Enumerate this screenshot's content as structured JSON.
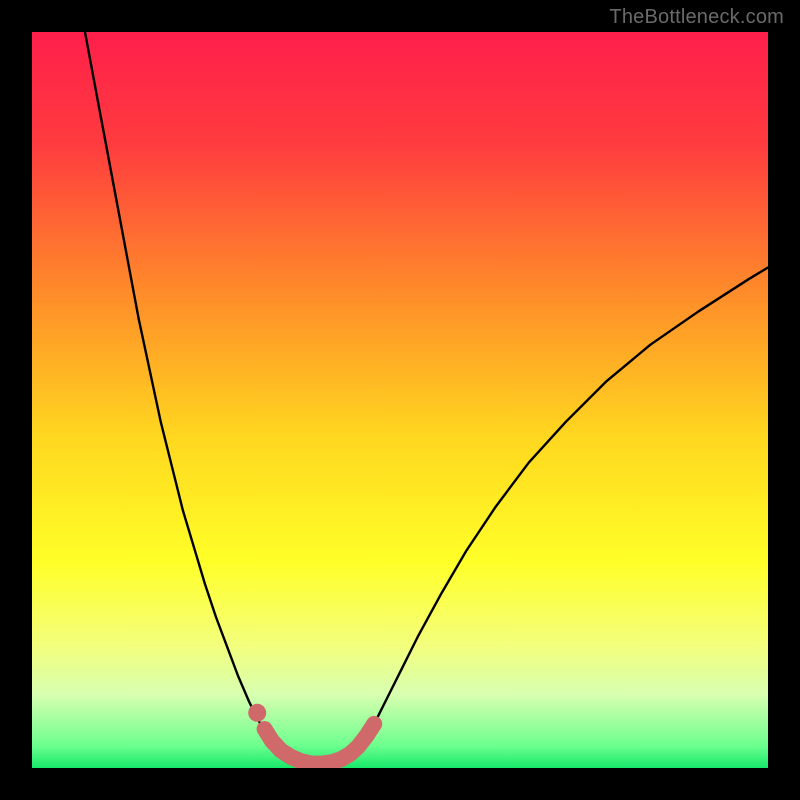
{
  "watermark": "TheBottleneck.com",
  "chart_data": {
    "type": "line",
    "title": "",
    "xlabel": "",
    "ylabel": "",
    "xlim": [
      0,
      1
    ],
    "ylim": [
      0,
      1
    ],
    "gradient_stops": [
      {
        "offset": 0.0,
        "color": "#ff1f4b"
      },
      {
        "offset": 0.15,
        "color": "#ff3b3f"
      },
      {
        "offset": 0.35,
        "color": "#ff8a2a"
      },
      {
        "offset": 0.55,
        "color": "#ffd71f"
      },
      {
        "offset": 0.72,
        "color": "#ffff28"
      },
      {
        "offset": 0.83,
        "color": "#f4ff7a"
      },
      {
        "offset": 0.9,
        "color": "#d8ffb0"
      },
      {
        "offset": 0.97,
        "color": "#6cff8e"
      },
      {
        "offset": 1.0,
        "color": "#17e86b"
      }
    ],
    "series": [
      {
        "name": "main-curve",
        "stroke": "#000000",
        "stroke_width": 2.4,
        "points": [
          [
            0.072,
            1.0
          ],
          [
            0.085,
            0.93
          ],
          [
            0.1,
            0.85
          ],
          [
            0.115,
            0.77
          ],
          [
            0.13,
            0.69
          ],
          [
            0.145,
            0.61
          ],
          [
            0.16,
            0.54
          ],
          [
            0.175,
            0.47
          ],
          [
            0.19,
            0.41
          ],
          [
            0.205,
            0.35
          ],
          [
            0.22,
            0.3
          ],
          [
            0.235,
            0.25
          ],
          [
            0.25,
            0.205
          ],
          [
            0.265,
            0.165
          ],
          [
            0.28,
            0.125
          ],
          [
            0.295,
            0.09
          ],
          [
            0.305,
            0.07
          ],
          [
            0.313,
            0.055
          ],
          [
            0.32,
            0.043
          ],
          [
            0.328,
            0.033
          ],
          [
            0.335,
            0.025
          ],
          [
            0.345,
            0.017
          ],
          [
            0.355,
            0.011
          ],
          [
            0.365,
            0.007
          ],
          [
            0.375,
            0.0045
          ],
          [
            0.385,
            0.0035
          ],
          [
            0.395,
            0.0035
          ],
          [
            0.405,
            0.005
          ],
          [
            0.415,
            0.008
          ],
          [
            0.425,
            0.013
          ],
          [
            0.435,
            0.02
          ],
          [
            0.445,
            0.03
          ],
          [
            0.455,
            0.043
          ],
          [
            0.465,
            0.06
          ],
          [
            0.48,
            0.09
          ],
          [
            0.5,
            0.13
          ],
          [
            0.525,
            0.18
          ],
          [
            0.555,
            0.235
          ],
          [
            0.59,
            0.295
          ],
          [
            0.63,
            0.355
          ],
          [
            0.675,
            0.415
          ],
          [
            0.725,
            0.47
          ],
          [
            0.78,
            0.525
          ],
          [
            0.84,
            0.575
          ],
          [
            0.905,
            0.62
          ],
          [
            0.975,
            0.665
          ],
          [
            1.0,
            0.68
          ]
        ]
      },
      {
        "name": "highlight-segment",
        "stroke": "#d06a6a",
        "stroke_width": 16,
        "points": [
          [
            0.316,
            0.053
          ],
          [
            0.326,
            0.037
          ],
          [
            0.338,
            0.024
          ],
          [
            0.352,
            0.015
          ],
          [
            0.366,
            0.009
          ],
          [
            0.38,
            0.006
          ],
          [
            0.395,
            0.006
          ],
          [
            0.408,
            0.008
          ],
          [
            0.42,
            0.012
          ],
          [
            0.432,
            0.019
          ],
          [
            0.443,
            0.029
          ],
          [
            0.454,
            0.043
          ],
          [
            0.465,
            0.06
          ]
        ]
      },
      {
        "name": "highlight-dot",
        "type": "point",
        "fill": "#d06a6a",
        "radius": 9,
        "point": [
          0.306,
          0.075
        ]
      }
    ]
  }
}
